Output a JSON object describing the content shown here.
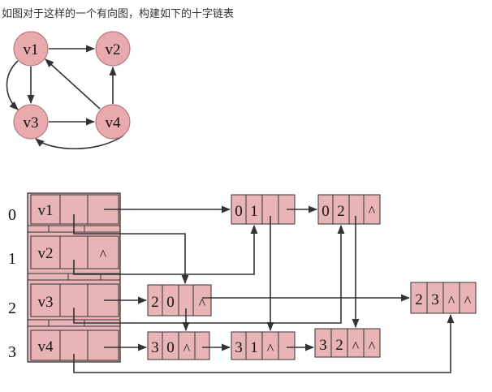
{
  "title": "如图对于这样的一个有向图，构建如下的十字链表",
  "colors": {
    "cell_fill": "#e8b4b6",
    "node_fill": "#e9aaae",
    "line": "#333333"
  },
  "graph": {
    "vertices": [
      "v1",
      "v2",
      "v3",
      "v4"
    ],
    "edges": [
      [
        "v1",
        "v2"
      ],
      [
        "v1",
        "v3"
      ],
      [
        "v3",
        "v1"
      ],
      [
        "v3",
        "v4"
      ],
      [
        "v4",
        "v1"
      ],
      [
        "v4",
        "v2"
      ],
      [
        "v4",
        "v3"
      ]
    ]
  },
  "orthogonal_list": {
    "row_indices": [
      "0",
      "1",
      "2",
      "3"
    ],
    "vertex_labels": [
      "v1",
      "v2",
      "v3",
      "v4"
    ],
    "null_symbol": "^",
    "arc_nodes": [
      {
        "tail": "0",
        "head": "1"
      },
      {
        "tail": "0",
        "head": "2"
      },
      {
        "tail": "2",
        "head": "0"
      },
      {
        "tail": "2",
        "head": "3"
      },
      {
        "tail": "3",
        "head": "0"
      },
      {
        "tail": "3",
        "head": "1"
      },
      {
        "tail": "3",
        "head": "2"
      }
    ]
  }
}
